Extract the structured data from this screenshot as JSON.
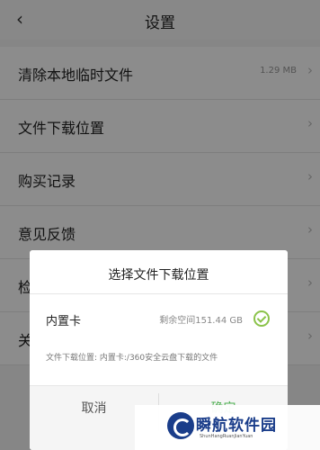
{
  "header": {
    "back_icon": "chevron-left-icon",
    "title": "设置"
  },
  "settings": {
    "items": [
      {
        "label": "清除本地临时文件",
        "value": "1.29 MB"
      },
      {
        "label": "文件下载位置",
        "value": ""
      },
      {
        "label": "购买记录",
        "value": ""
      },
      {
        "label": "意见反馈",
        "value": ""
      },
      {
        "label": "检",
        "value": ""
      },
      {
        "label": "关",
        "value": ""
      }
    ],
    "chevron_icon": "chevron-right-icon"
  },
  "dialog": {
    "title": "选择文件下载位置",
    "option": {
      "label": "内置卡",
      "space": "剩余空间151.44 GB",
      "selected": true,
      "check_color": "#8bc34a"
    },
    "path": "文件下载位置: 内置卡:/360安全云盘下载的文件",
    "cancel_label": "取消",
    "ok_label": "确定"
  },
  "watermark": {
    "text": "瞬航软件园",
    "sub": "ShunHangRuanJianYuan"
  }
}
